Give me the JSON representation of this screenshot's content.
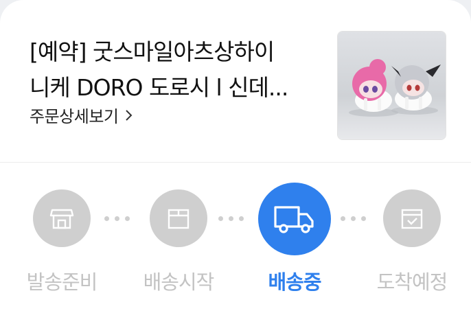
{
  "order": {
    "title_line1": "[예약] 굿스마일아츠상하이",
    "title_line2": "니케 DORO 도로시 l 신데...",
    "detail_link": "주문상세보기"
  },
  "tracking": {
    "steps": [
      {
        "label": "발송준비",
        "icon": "store-icon",
        "active": false
      },
      {
        "label": "배송시작",
        "icon": "box-icon",
        "active": false
      },
      {
        "label": "배송중",
        "icon": "truck-icon",
        "active": true
      },
      {
        "label": "도착예정",
        "icon": "box-check-icon",
        "active": false
      }
    ]
  },
  "colors": {
    "accent": "#2f80ed",
    "inactive": "#cfcfcf",
    "inactive_text": "#c3c3c3"
  }
}
